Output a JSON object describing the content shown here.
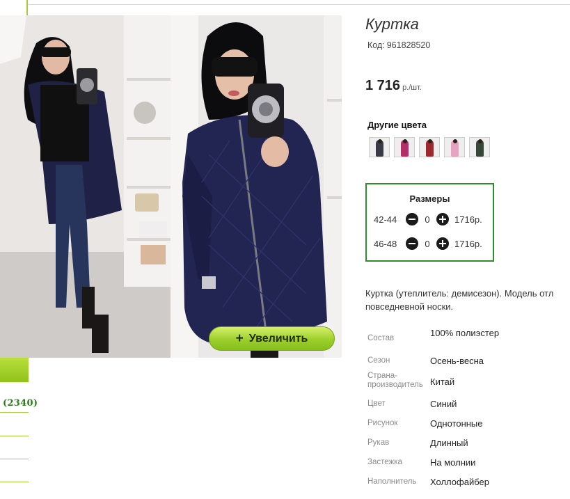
{
  "sidebar": {
    "count_label": "(2340)"
  },
  "gallery": {
    "zoom_label": "Увеличить",
    "zoom_icon": "plus-icon"
  },
  "product": {
    "title": "Куртка",
    "code_label": "Код:",
    "code": "961828520",
    "price": "1 716",
    "price_unit": "р./шт."
  },
  "colors": {
    "title": "Другие цвета",
    "swatches": [
      {
        "color": "#3a3a46"
      },
      {
        "color": "#b0306a"
      },
      {
        "color": "#9a2a2e"
      },
      {
        "color": "#e6a3bf"
      },
      {
        "color": "#36463a"
      }
    ]
  },
  "sizes": {
    "title": "Размеры",
    "rows": [
      {
        "size": "42-44",
        "qty": "0",
        "price": "1716р."
      },
      {
        "size": "46-48",
        "qty": "0",
        "price": "1716р."
      }
    ]
  },
  "description": {
    "line1": "Куртка (утеплитель: демисезон). Модель отл",
    "line2": "повседневной носки."
  },
  "properties": [
    {
      "key": "Состав",
      "value": "100% полиэстер"
    },
    {
      "key": "Сезон",
      "value": "Осень-весна"
    },
    {
      "key": "Страна-производитель",
      "value": "Китай"
    },
    {
      "key": "Цвет",
      "value": "Синий"
    },
    {
      "key": "Рисунок",
      "value": "Однотонные"
    },
    {
      "key": "Рукав",
      "value": "Длинный"
    },
    {
      "key": "Застежка",
      "value": "На молнии"
    },
    {
      "key": "Наполнитель",
      "value": "Холлофайбер"
    }
  ],
  "theme": {
    "accent": "#9ccf2c",
    "sizes_border": "#2f8d2a",
    "link_green": "#2d7d1a"
  }
}
